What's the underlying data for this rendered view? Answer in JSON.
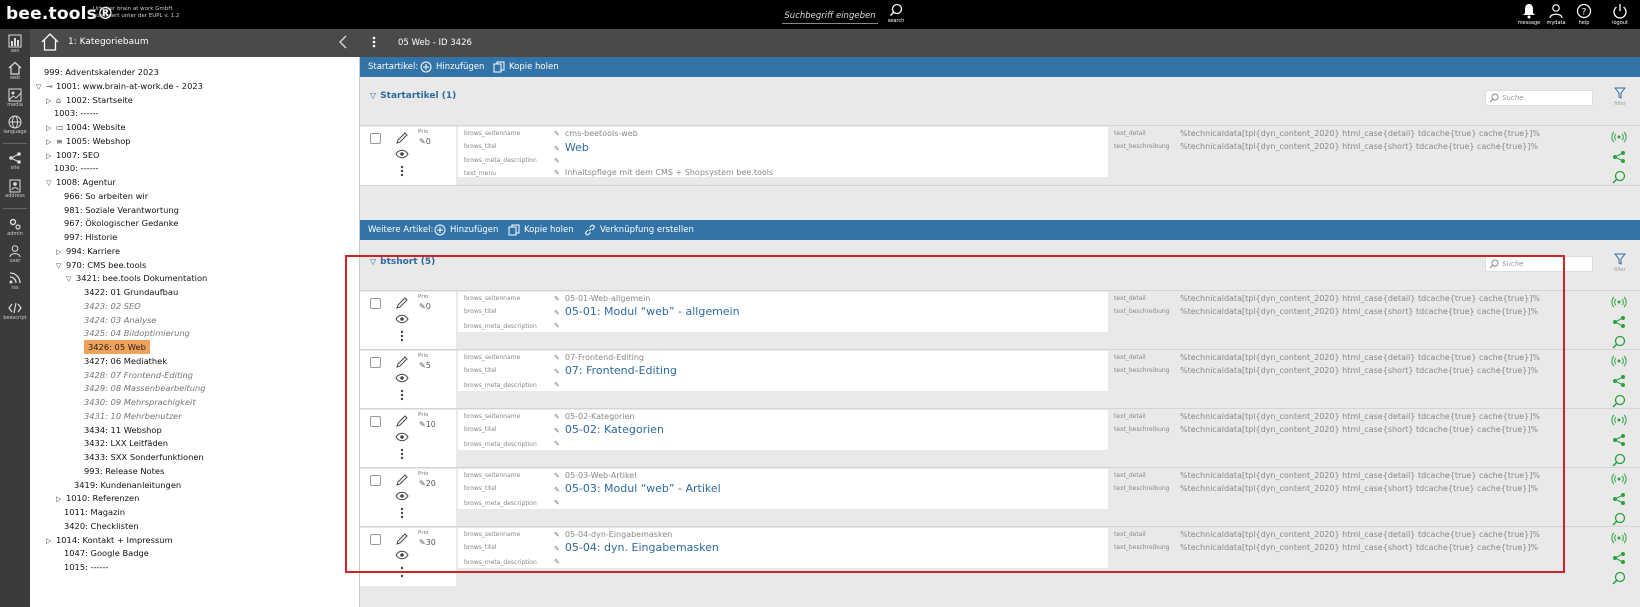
{
  "topbar": {
    "brand": "bee.tools®",
    "brand_sub_1": "Urheber brain at work GmbH",
    "brand_sub_2": "Lizenziert unter der EUPL v. 1.2",
    "search_placeholder": "Suchbegriff eingeben",
    "search_label": "search",
    "icons": [
      {
        "name": "message",
        "label": "message"
      },
      {
        "name": "mydata",
        "label": "mydata"
      },
      {
        "name": "help",
        "label": "help"
      },
      {
        "name": "logout",
        "label": "logout"
      }
    ]
  },
  "leftnav": [
    {
      "label": "seo",
      "icon": "chart-icon"
    },
    {
      "label": "web",
      "icon": "home-icon"
    },
    {
      "label": "media",
      "icon": "image-icon"
    },
    {
      "label": "language",
      "icon": "globe-icon"
    },
    {
      "label": "site",
      "icon": "sitemap-icon"
    },
    {
      "label": "address",
      "icon": "address-icon"
    },
    {
      "label": "admin",
      "icon": "gear-icon"
    },
    {
      "label": "user",
      "icon": "user-icon"
    },
    {
      "label": "rss",
      "icon": "rss-icon"
    },
    {
      "label": "beescript",
      "icon": "code-icon"
    }
  ],
  "tree": {
    "title": "1: Kategoriebaum",
    "rows": [
      {
        "text": "999: Adventskalender 2023",
        "tog": "",
        "ico": "",
        "italic": false,
        "selected": false
      },
      {
        "text": "1001: www.brain-at-work.de - 2023",
        "tog": "▽",
        "ico": "⊸",
        "italic": false,
        "selected": false
      },
      {
        "text": "1002: Startseite",
        "tog": "▷",
        "ico": "⌂",
        "italic": false,
        "selected": false
      },
      {
        "text": "1003: ------",
        "tog": "",
        "ico": "",
        "italic": false,
        "selected": false
      },
      {
        "text": "1004: Website",
        "tog": "▷",
        "ico": "▭",
        "italic": false,
        "selected": false
      },
      {
        "text": "1005: Webshop",
        "tog": "▷",
        "ico": "≡",
        "italic": false,
        "selected": false
      },
      {
        "text": "1007: SEO",
        "tog": "▷",
        "ico": "",
        "italic": false,
        "selected": false
      },
      {
        "text": "1030: ------",
        "tog": "",
        "ico": "",
        "italic": false,
        "selected": false
      },
      {
        "text": "1008: Agentur",
        "tog": "▽",
        "ico": "",
        "italic": false,
        "selected": false
      },
      {
        "text": "966: So arbeiten wir",
        "tog": "",
        "ico": "",
        "italic": false,
        "selected": false
      },
      {
        "text": "981: Soziale Verantwortung",
        "tog": "",
        "ico": "",
        "italic": false,
        "selected": false
      },
      {
        "text": "967: Ökologischer Gedanke",
        "tog": "",
        "ico": "",
        "italic": false,
        "selected": false
      },
      {
        "text": "997: Historie",
        "tog": "",
        "ico": "",
        "italic": false,
        "selected": false
      },
      {
        "text": "994: Karriere",
        "tog": "▷",
        "ico": "",
        "italic": false,
        "selected": false
      },
      {
        "text": "970: CMS bee.tools",
        "tog": "▽",
        "ico": "",
        "italic": false,
        "selected": false
      },
      {
        "text": "3421: bee.tools Dokumentation",
        "tog": "▽",
        "ico": "",
        "italic": false,
        "selected": false
      },
      {
        "text": "3422: 01 Grundaufbau",
        "tog": "",
        "ico": "",
        "italic": false,
        "selected": false
      },
      {
        "text": "3423: 02 SEO",
        "tog": "",
        "ico": "",
        "italic": true,
        "selected": false
      },
      {
        "text": "3424: 03 Analyse",
        "tog": "",
        "ico": "",
        "italic": true,
        "selected": false
      },
      {
        "text": "3425: 04 Bildoptimierung",
        "tog": "",
        "ico": "",
        "italic": true,
        "selected": false
      },
      {
        "text": "3426: 05 Web",
        "tog": "",
        "ico": "",
        "italic": false,
        "selected": true
      },
      {
        "text": "3427: 06 Mediathek",
        "tog": "",
        "ico": "",
        "italic": false,
        "selected": false
      },
      {
        "text": "3428: 07 Frontend-Editing",
        "tog": "",
        "ico": "",
        "italic": true,
        "selected": false
      },
      {
        "text": "3429: 08 Massenbearbeitung",
        "tog": "",
        "ico": "",
        "italic": true,
        "selected": false
      },
      {
        "text": "3430: 09 Mehrsprachigkeit",
        "tog": "",
        "ico": "",
        "italic": true,
        "selected": false
      },
      {
        "text": "3431: 10 Mehrbenutzer",
        "tog": "",
        "ico": "",
        "italic": true,
        "selected": false
      },
      {
        "text": "3434: 11 Webshop",
        "tog": "",
        "ico": "",
        "italic": false,
        "selected": false
      },
      {
        "text": "3432: LXX Leitfäden",
        "tog": "",
        "ico": "",
        "italic": false,
        "selected": false
      },
      {
        "text": "3433: SXX Sonderfunktionen",
        "tog": "",
        "ico": "",
        "italic": false,
        "selected": false
      },
      {
        "text": "993: Release Notes",
        "tog": "",
        "ico": "",
        "italic": false,
        "selected": false
      },
      {
        "text": "3419: Kundenanleitungen",
        "tog": "",
        "ico": "",
        "italic": false,
        "selected": false
      },
      {
        "text": "1010: Referenzen",
        "tog": "▷",
        "ico": "",
        "italic": false,
        "selected": false
      },
      {
        "text": "1011: Magazin",
        "tog": "",
        "ico": "",
        "italic": false,
        "selected": false
      },
      {
        "text": "3420: Checklisten",
        "tog": "",
        "ico": "",
        "italic": false,
        "selected": false
      },
      {
        "text": "1014: Kontakt + Impressum",
        "tog": "▷",
        "ico": "",
        "italic": false,
        "selected": false
      },
      {
        "text": "1047: Google Badge",
        "tog": "",
        "ico": "",
        "italic": false,
        "selected": false
      },
      {
        "text": "1015: ------",
        "tog": "",
        "ico": "",
        "italic": false,
        "selected": false
      }
    ]
  },
  "main": {
    "title": "05 Web - ID 3426",
    "start_bar": {
      "label": "Startartikel:",
      "add": "Hinzufügen",
      "copy": "Kopie holen"
    },
    "start_section": {
      "title": "Startartikel (1)",
      "search_placeholder": "Suche",
      "filter_label": "filter"
    },
    "further_bar": {
      "label": "Weitere Artikel:",
      "add": "Hinzufügen",
      "copy": "Kopie holen",
      "link": "Verknüpfung erstellen"
    },
    "short_section": {
      "title": "btshort (5)",
      "search_placeholder": "Suche",
      "filter_label": "filter"
    },
    "field_labels": {
      "seitenname": "brows_seitenname",
      "titel": "brows_titel",
      "meta": "brows_meta_description",
      "menu": "text_menu",
      "detail": "text_detail",
      "beschreibung": "text_beschreibung",
      "prio": "Prio"
    },
    "start_article": {
      "prio": "0",
      "seitenname": "cms-beetools-web",
      "titel": "Web",
      "menu": "Inhaltspflege mit dem CMS + Shopsystem bee.tools",
      "detail": "%technicaldata[tpl{dyn_content_2020} html_case{detail} tdcache{true} cache{true}]%",
      "beschreibung": "%technicaldata[tpl{dyn_content_2020} html_case{short} tdcache{true} cache{true}]%"
    },
    "articles": [
      {
        "prio": "0",
        "seitenname": "05-01-Web-allgemein",
        "titel": "05-01: Modul “web” - allgemein",
        "detail": "%technicaldata[tpl{dyn_content_2020} html_case{detail} tdcache{true} cache{true}]%",
        "beschreibung": "%technicaldata[tpl{dyn_content_2020} html_case{short} tdcache{true} cache{true}]%"
      },
      {
        "prio": "5",
        "seitenname": "07-Frontend-Editing",
        "titel": "07: Frontend-Editing",
        "detail": "%technicaldata[tpl{dyn_content_2020} html_case{detail} tdcache{true} cache{true}]%",
        "beschreibung": "%technicaldata[tpl{dyn_content_2020} html_case{short} tdcache{true} cache{true}]%"
      },
      {
        "prio": "10",
        "seitenname": "05-02-Kategorien",
        "titel": "05-02: Kategorien",
        "detail": "%technicaldata[tpl{dyn_content_2020} html_case{detail} tdcache{true} cache{true}]%",
        "beschreibung": "%technicaldata[tpl{dyn_content_2020} html_case{short} tdcache{true} cache{true}]%"
      },
      {
        "prio": "20",
        "seitenname": "05-03-Web-Artikel",
        "titel": "05-03: Modul “web” - Artikel",
        "detail": "%technicaldata[tpl{dyn_content_2020} html_case{detail} tdcache{true} cache{true}]%",
        "beschreibung": "%technicaldata[tpl{dyn_content_2020} html_case{short} tdcache{true} cache{true}]%"
      },
      {
        "prio": "30",
        "seitenname": "05-04-dyn-Eingabemasken",
        "titel": "05-04: dyn. Eingabemasken",
        "detail": "%technicaldata[tpl{dyn_content_2020} html_case{detail} tdcache{true} cache{true}]%",
        "beschreibung": "%technicaldata[tpl{dyn_content_2020} html_case{short} tdcache{true} cache{true}]%"
      }
    ]
  },
  "colors": {
    "accent_blue": "#3273a8",
    "selected_orange": "#f0a25b",
    "action_green": "#2aa13c",
    "highlight_red": "#d2232a"
  }
}
